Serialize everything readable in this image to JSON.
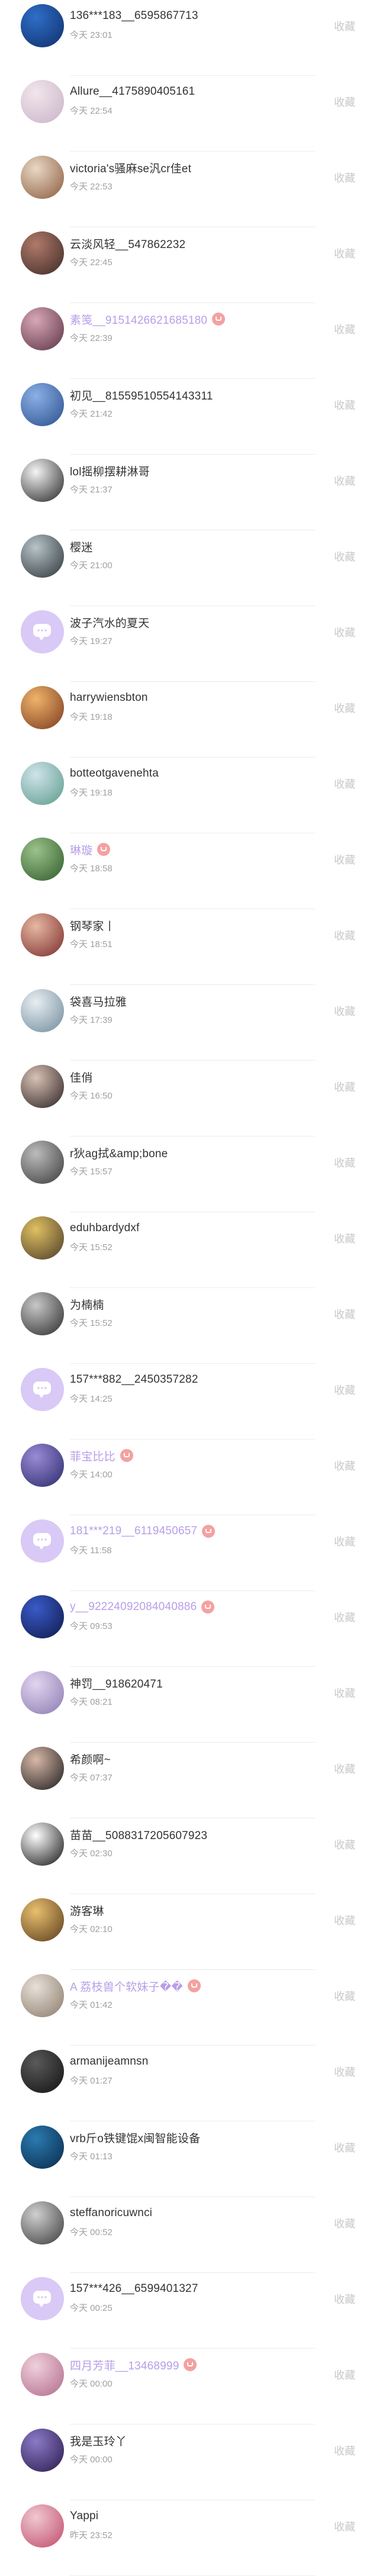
{
  "collect_label": "收藏",
  "colors": {
    "vip_name": "#b79ee8",
    "vip_badge": "#f4a1a1",
    "default_avatar": "#d9c9f6",
    "time_text": "#a0a0a0",
    "collect_text": "#c8c8c8"
  },
  "users": [
    {
      "name": "136***183__6595867713",
      "time": "今天 23:01",
      "vip": false,
      "avatar": "photo",
      "avatar_colors": [
        "#2f6ec8",
        "#0f2f6a"
      ]
    },
    {
      "name": "Allure__4175890405161",
      "time": "今天 22:54",
      "vip": false,
      "avatar": "photo",
      "avatar_colors": [
        "#f1e6ea",
        "#c9b2c8"
      ]
    },
    {
      "name": "victoria's骚麻se汎cr佳et",
      "time": "今天 22:53",
      "vip": false,
      "avatar": "photo",
      "avatar_colors": [
        "#e9d8c4",
        "#8a5a3e"
      ]
    },
    {
      "name": "云淡风轻__547862232",
      "time": "今天 22:45",
      "vip": false,
      "avatar": "photo",
      "avatar_colors": [
        "#b07a6a",
        "#3e2a26"
      ]
    },
    {
      "name": "素笺__9151426621685180",
      "time": "今天 22:39",
      "vip": true,
      "avatar": "photo",
      "avatar_colors": [
        "#d8a7b5",
        "#5a3346"
      ]
    },
    {
      "name": "初见__81559510554143311",
      "time": "今天 21:42",
      "vip": false,
      "avatar": "photo",
      "avatar_colors": [
        "#8bb0e6",
        "#2a4e8c"
      ]
    },
    {
      "name": "lol摇柳摆耕淋哥",
      "time": "今天 21:37",
      "vip": false,
      "avatar": "photo",
      "avatar_colors": [
        "#f5f5f5",
        "#222222"
      ]
    },
    {
      "name": "樱迷",
      "time": "今天 21:00",
      "vip": false,
      "avatar": "photo",
      "avatar_colors": [
        "#b8c4c8",
        "#2c3438"
      ]
    },
    {
      "name": "波子汽水的夏天",
      "time": "今天 19:27",
      "vip": false,
      "avatar": "default",
      "avatar_colors": []
    },
    {
      "name": "harrywiensbton",
      "time": "今天 19:18",
      "vip": false,
      "avatar": "photo",
      "avatar_colors": [
        "#f0b36a",
        "#7a3a1e"
      ]
    },
    {
      "name": "botteotgavenehta",
      "time": "今天 19:18",
      "vip": false,
      "avatar": "photo",
      "avatar_colors": [
        "#cfe3ea",
        "#5d9a8c"
      ]
    },
    {
      "name": "琳璇",
      "time": "今天 18:58",
      "vip": true,
      "avatar": "photo",
      "avatar_colors": [
        "#9cc28a",
        "#2e5a2a"
      ]
    },
    {
      "name": "钢琴家丨",
      "time": "今天 18:51",
      "vip": false,
      "avatar": "photo",
      "avatar_colors": [
        "#e6b8a2",
        "#7a2a2a"
      ]
    },
    {
      "name": "袋喜马拉雅",
      "time": "今天 17:39",
      "vip": false,
      "avatar": "photo",
      "avatar_colors": [
        "#e8eef2",
        "#6f8a9a"
      ]
    },
    {
      "name": "佳俏",
      "time": "今天 16:50",
      "vip": false,
      "avatar": "photo",
      "avatar_colors": [
        "#d9c2b6",
        "#2a2020"
      ]
    },
    {
      "name": "r狄ag拭&amp;bone",
      "time": "今天 15:57",
      "vip": false,
      "avatar": "photo",
      "avatar_colors": [
        "#bcbcbc",
        "#3a3a3a"
      ]
    },
    {
      "name": "eduhbardydxf",
      "time": "今天 15:52",
      "vip": false,
      "avatar": "photo",
      "avatar_colors": [
        "#e0c060",
        "#4a3a2a"
      ]
    },
    {
      "name": "为楠楠",
      "time": "今天 15:52",
      "vip": false,
      "avatar": "photo",
      "avatar_colors": [
        "#c8c8c8",
        "#2a2a2a"
      ]
    },
    {
      "name": "157***882__2450357282",
      "time": "今天 14:25",
      "vip": false,
      "avatar": "default",
      "avatar_colors": []
    },
    {
      "name": "菲宝比比",
      "time": "今天 14:00",
      "vip": true,
      "avatar": "photo",
      "avatar_colors": [
        "#9a8ad6",
        "#2a2a6a"
      ]
    },
    {
      "name": "181***219__6119450657",
      "time": "今天 11:58",
      "vip": true,
      "avatar": "default",
      "avatar_colors": []
    },
    {
      "name": "y__92224092084040886",
      "time": "今天 09:53",
      "vip": true,
      "avatar": "photo",
      "avatar_colors": [
        "#3a5ac8",
        "#0e1a4a"
      ]
    },
    {
      "name": "神罚__918620471",
      "time": "今天 08:21",
      "vip": false,
      "avatar": "photo",
      "avatar_colors": [
        "#e2d4f0",
        "#8a7ab0"
      ]
    },
    {
      "name": "希颜啊~",
      "time": "今天 07:37",
      "vip": false,
      "avatar": "photo",
      "avatar_colors": [
        "#d8b8a8",
        "#1a1a1a"
      ]
    },
    {
      "name": "苗苗__5088317205607923",
      "time": "今天 02:30",
      "vip": false,
      "avatar": "photo",
      "avatar_colors": [
        "#ffffff",
        "#111111"
      ]
    },
    {
      "name": "游客琳",
      "time": "今天 02:10",
      "vip": false,
      "avatar": "photo",
      "avatar_colors": [
        "#e8c070",
        "#5a3a1a"
      ]
    },
    {
      "name": "A 荔枝兽个软妹子�� ",
      "time": "今天 01:42",
      "vip": true,
      "avatar": "photo",
      "avatar_colors": [
        "#e8e0d8",
        "#8a7a6a"
      ]
    },
    {
      "name": "armanijeamnsn",
      "time": "今天 01:27",
      "vip": false,
      "avatar": "photo",
      "avatar_colors": [
        "#5a5a5a",
        "#111111"
      ]
    },
    {
      "name": "vrb斤o铁键馄x闽智能设备",
      "time": "今天 01:13",
      "vip": false,
      "avatar": "photo",
      "avatar_colors": [
        "#2a7ab0",
        "#0a2a4a"
      ]
    },
    {
      "name": "steffanoricuwnci",
      "time": "今天 00:52",
      "vip": false,
      "avatar": "photo",
      "avatar_colors": [
        "#d0d0d0",
        "#3a3a3a"
      ]
    },
    {
      "name": "157***426__6599401327",
      "time": "今天 00:25",
      "vip": false,
      "avatar": "default",
      "avatar_colors": []
    },
    {
      "name": "四月芳菲__13468999",
      "time": "今天 00:00",
      "vip": true,
      "avatar": "photo",
      "avatar_colors": [
        "#f0d0dc",
        "#b06a8a"
      ]
    },
    {
      "name": "我是玉玲丫",
      "time": "今天 00:00",
      "vip": false,
      "avatar": "photo",
      "avatar_colors": [
        "#8a7ac8",
        "#2a1a4a"
      ]
    },
    {
      "name": "Yappi",
      "time": "昨天 23:52",
      "vip": false,
      "avatar": "photo",
      "avatar_colors": [
        "#f0c8d0",
        "#c04a6a"
      ]
    }
  ]
}
